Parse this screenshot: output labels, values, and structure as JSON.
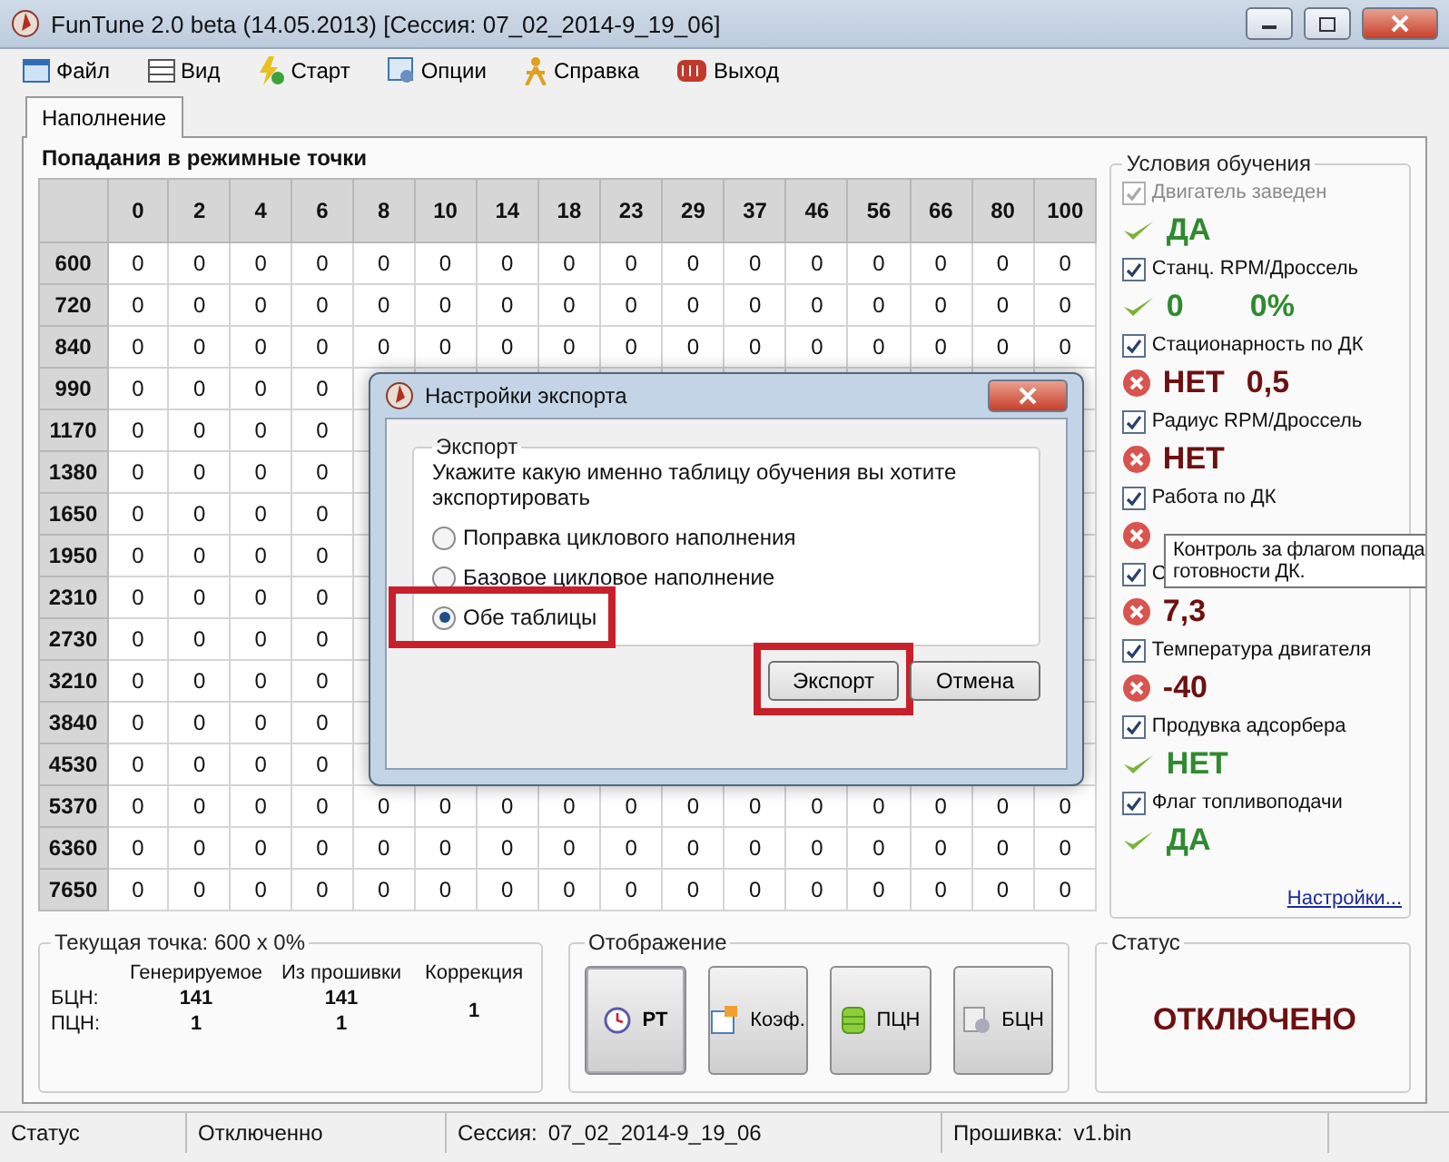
{
  "window": {
    "title": "FunTune 2.0 beta (14.05.2013) [Сессия: 07_02_2014-9_19_06]"
  },
  "menu": [
    {
      "label": "Файл",
      "kind": "file"
    },
    {
      "label": "Вид",
      "kind": "view"
    },
    {
      "label": "Старт",
      "kind": "start"
    },
    {
      "label": "Опции",
      "kind": "options"
    },
    {
      "label": "Справка",
      "kind": "help"
    },
    {
      "label": "Выход",
      "kind": "exit"
    }
  ],
  "tabs": [
    {
      "label": "Наполнение",
      "selected": true
    }
  ],
  "table": {
    "title": "Попадания в режимные точки",
    "columns": [
      "0",
      "2",
      "4",
      "6",
      "8",
      "10",
      "14",
      "18",
      "23",
      "29",
      "37",
      "46",
      "56",
      "66",
      "80",
      "100"
    ],
    "rows": [
      {
        "label": "600",
        "cells": [
          "0",
          "0",
          "0",
          "0",
          "0",
          "0",
          "0",
          "0",
          "0",
          "0",
          "0",
          "0",
          "0",
          "0",
          "0",
          "0"
        ]
      },
      {
        "label": "720",
        "cells": [
          "0",
          "0",
          "0",
          "0",
          "0",
          "0",
          "0",
          "0",
          "0",
          "0",
          "0",
          "0",
          "0",
          "0",
          "0",
          "0"
        ]
      },
      {
        "label": "840",
        "cells": [
          "0",
          "0",
          "0",
          "0",
          "0",
          "0",
          "0",
          "0",
          "0",
          "0",
          "0",
          "0",
          "0",
          "0",
          "0",
          "0"
        ]
      },
      {
        "label": "990",
        "cells": [
          "0",
          "0",
          "0",
          "0"
        ]
      },
      {
        "label": "1170",
        "cells": [
          "0",
          "0",
          "0",
          "0"
        ]
      },
      {
        "label": "1380",
        "cells": [
          "0",
          "0",
          "0",
          "0"
        ]
      },
      {
        "label": "1650",
        "cells": [
          "0",
          "0",
          "0",
          "0"
        ]
      },
      {
        "label": "1950",
        "cells": [
          "0",
          "0",
          "0",
          "0"
        ]
      },
      {
        "label": "2310",
        "cells": [
          "0",
          "0",
          "0",
          "0"
        ]
      },
      {
        "label": "2730",
        "cells": [
          "0",
          "0",
          "0",
          "0"
        ]
      },
      {
        "label": "3210",
        "cells": [
          "0",
          "0",
          "0",
          "0"
        ]
      },
      {
        "label": "3840",
        "cells": [
          "0",
          "0",
          "0",
          "0"
        ]
      },
      {
        "label": "4530",
        "cells": [
          "0",
          "0",
          "0",
          "0"
        ]
      },
      {
        "label": "5370",
        "cells": [
          "0",
          "0",
          "0",
          "0",
          "0",
          "0",
          "0",
          "0",
          "0",
          "0",
          "0",
          "0",
          "0",
          "0",
          "0",
          "0"
        ]
      },
      {
        "label": "6360",
        "cells": [
          "0",
          "0",
          "0",
          "0",
          "0",
          "0",
          "0",
          "0",
          "0",
          "0",
          "0",
          "0",
          "0",
          "0",
          "0",
          "0"
        ]
      },
      {
        "label": "7650",
        "cells": [
          "0",
          "0",
          "0",
          "0",
          "0",
          "0",
          "0",
          "0",
          "0",
          "0",
          "0",
          "0",
          "0",
          "0",
          "0",
          "0"
        ]
      }
    ]
  },
  "conditions": {
    "title": "Условия обучения",
    "items": [
      {
        "label": "Двигатель заведен",
        "checked": true,
        "disabled": true,
        "ok": true,
        "values": [
          "ДА"
        ]
      },
      {
        "label": "Станц. RPM/Дроссель",
        "checked": true,
        "disabled": false,
        "ok": true,
        "values": [
          "0",
          "0%"
        ]
      },
      {
        "label": "Стационарность по ДК",
        "checked": true,
        "disabled": false,
        "ok": false,
        "values": [
          "НЕТ",
          "0,5"
        ]
      },
      {
        "label": "Радиус RPM/Дроссель",
        "checked": true,
        "disabled": false,
        "ok": false,
        "values": [
          "НЕТ"
        ]
      },
      {
        "label": "Работа по ДК",
        "checked": true,
        "disabled": false,
        "ok": false
      },
      {
        "label": "С",
        "checked": true,
        "disabled": false,
        "ok": false,
        "values": [
          "7,3"
        ]
      },
      {
        "label": "Температура двигателя",
        "checked": true,
        "disabled": false,
        "ok": false,
        "values": [
          "-40"
        ]
      },
      {
        "label": "Продувка адсорбера",
        "checked": true,
        "disabled": false,
        "ok": true,
        "values": [
          "НЕТ"
        ]
      },
      {
        "label": "Флаг топливоподачи",
        "checked": true,
        "disabled": false,
        "ok": true,
        "values": [
          "ДА"
        ]
      }
    ],
    "link": "Настройки..."
  },
  "tooltip": {
    "lines": [
      "Контроль за флагом попада",
      "готовности ДК."
    ]
  },
  "current_point": {
    "title": "Текущая точка: 600 x 0%",
    "headers": [
      "Генерируемое",
      "Из прошивки",
      "Коррекция"
    ],
    "rows": [
      {
        "label": "БЦН:",
        "values": [
          "141",
          "141"
        ]
      },
      {
        "label": "ПЦН:",
        "values": [
          "1",
          "1"
        ]
      }
    ],
    "correction": "1"
  },
  "display": {
    "title": "Отображение",
    "buttons": [
      {
        "label": "РТ",
        "kind": "clock",
        "selected": true
      },
      {
        "label": "Коэф.",
        "kind": "note",
        "selected": false
      },
      {
        "label": "ПЦН",
        "kind": "db",
        "selected": false
      },
      {
        "label": "БЦН",
        "kind": "gear",
        "selected": false
      }
    ]
  },
  "status_panel": {
    "title": "Статус",
    "value": "ОТКЛЮЧЕНО"
  },
  "status_bar": [
    "Статус",
    "Отключенно",
    "Сессия:",
    "07_02_2014-9_19_06",
    "Прошивка:",
    "v1.bin"
  ],
  "dialog": {
    "title": "Настройки экспорта",
    "group": "Экспорт",
    "prompt": "Укажите какую именно таблицу обучения вы хотите экспортировать",
    "options": [
      {
        "label": "Поправка циклового наполнения",
        "selected": false,
        "highlighted": false
      },
      {
        "label": "Базовое цикловое наполнение",
        "selected": false,
        "highlighted": false
      },
      {
        "label": "Обе таблицы",
        "selected": true,
        "highlighted": true
      }
    ],
    "buttons": [
      {
        "label": "Экспорт",
        "highlighted": true
      },
      {
        "label": "Отмена",
        "highlighted": false
      }
    ]
  }
}
